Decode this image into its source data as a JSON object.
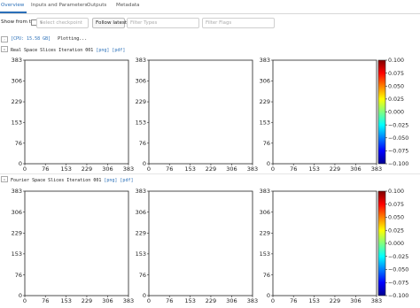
{
  "tabs": [
    {
      "label": "Overview",
      "active": true
    },
    {
      "label": "Inputs and Parameters",
      "active": false
    },
    {
      "label": "Outputs",
      "active": false
    },
    {
      "label": "Metadata",
      "active": false
    }
  ],
  "toolbar": {
    "show_from_top": "Show from top",
    "checkpoint_placeholder": "Select checkpoint",
    "follow_latest": "Follow latest",
    "filter_types_placeholder": "Filter Types",
    "filter_flags_placeholder": "Filter Flags"
  },
  "status": {
    "cpu": "[CPU: 15.58 GB]",
    "message": "Plotting..."
  },
  "sections": [
    {
      "title": "Real Space Slices Iteration 001",
      "png": "[png]",
      "pdf": "[pdf]"
    },
    {
      "title": "Fourier Space Slices Iteration 001",
      "png": "[png]",
      "pdf": "[pdf]"
    }
  ],
  "chart_data": [
    {
      "type": "heatmap",
      "panels": 3,
      "x_ticks": [
        "0",
        "76",
        "153",
        "229",
        "306",
        "383"
      ],
      "y_ticks": [
        "383",
        "306",
        "229",
        "153",
        "76",
        "0"
      ],
      "xlim": [
        0,
        383
      ],
      "ylim": [
        0,
        383
      ],
      "colorbar": {
        "ticks": [
          "0.100",
          "0.075",
          "0.050",
          "0.025",
          "0.000",
          "−0.025",
          "−0.050",
          "−0.075",
          "−0.100"
        ],
        "range": [
          -0.1,
          0.1
        ],
        "colormap": "jet"
      }
    },
    {
      "type": "heatmap",
      "panels": 3,
      "x_ticks": [
        "0",
        "76",
        "153",
        "229",
        "306",
        "383"
      ],
      "y_ticks": [
        "383",
        "306",
        "229",
        "153",
        "76",
        "0"
      ],
      "xlim": [
        0,
        383
      ],
      "ylim": [
        0,
        383
      ],
      "colorbar": {
        "ticks": [
          "0.100",
          "0.075",
          "0.050",
          "0.025",
          "0.000",
          "−0.025",
          "−0.050",
          "−0.075",
          "−0.100"
        ],
        "range": [
          -0.1,
          0.1
        ],
        "colormap": "jet"
      }
    }
  ]
}
